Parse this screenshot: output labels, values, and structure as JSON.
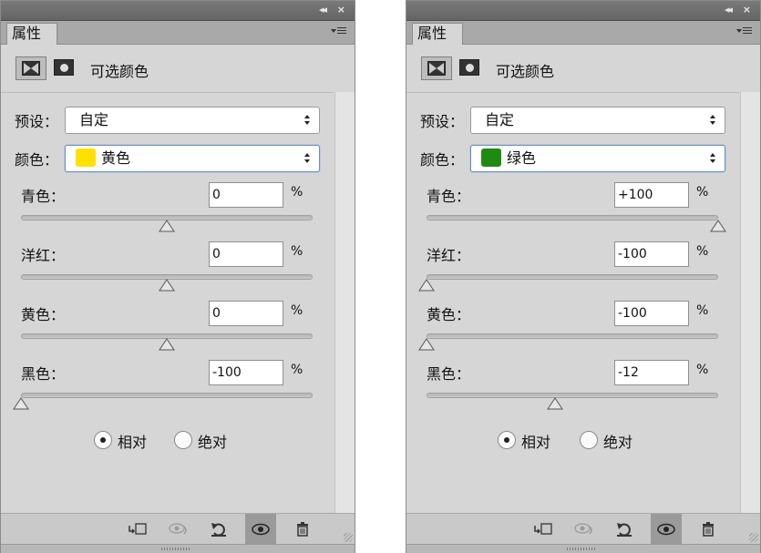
{
  "panels": [
    {
      "window_buttons": {
        "collapse": "◂◂",
        "close": "×"
      },
      "tab_label": "属性",
      "title": "可选颜色",
      "preset": {
        "label": "预设：",
        "value": "自定"
      },
      "colors": {
        "label": "颜色：",
        "value": "黄色",
        "swatch": "#ffe000"
      },
      "sliders": [
        {
          "label": "青色：",
          "value": "0",
          "unit": "%",
          "level": 0
        },
        {
          "label": "洋红：",
          "value": "0",
          "unit": "%",
          "level": 0
        },
        {
          "label": "黄色：",
          "value": "0",
          "unit": "%",
          "level": 0
        },
        {
          "label": "黑色：",
          "value": "-100",
          "unit": "%",
          "level": -100
        }
      ],
      "method": {
        "relative": "相对",
        "absolute": "绝对",
        "selected": "relative"
      }
    },
    {
      "window_buttons": {
        "collapse": "◂◂",
        "close": "×"
      },
      "tab_label": "属性",
      "title": "可选颜色",
      "preset": {
        "label": "预设：",
        "value": "自定"
      },
      "colors": {
        "label": "颜色：",
        "value": "绿色",
        "swatch": "#1f8a12"
      },
      "sliders": [
        {
          "label": "青色：",
          "value": "+100",
          "unit": "%",
          "level": 100
        },
        {
          "label": "洋红：",
          "value": "-100",
          "unit": "%",
          "level": -100
        },
        {
          "label": "黄色：",
          "value": "-100",
          "unit": "%",
          "level": -100
        },
        {
          "label": "黑色：",
          "value": "-12",
          "unit": "%",
          "level": -12
        }
      ],
      "method": {
        "relative": "相对",
        "absolute": "绝对",
        "selected": "relative"
      }
    }
  ],
  "toolbar_icons": [
    "clip-to-layer-icon",
    "toggle-visibility-previous-icon",
    "reset-icon",
    "eye-icon",
    "trash-icon"
  ]
}
